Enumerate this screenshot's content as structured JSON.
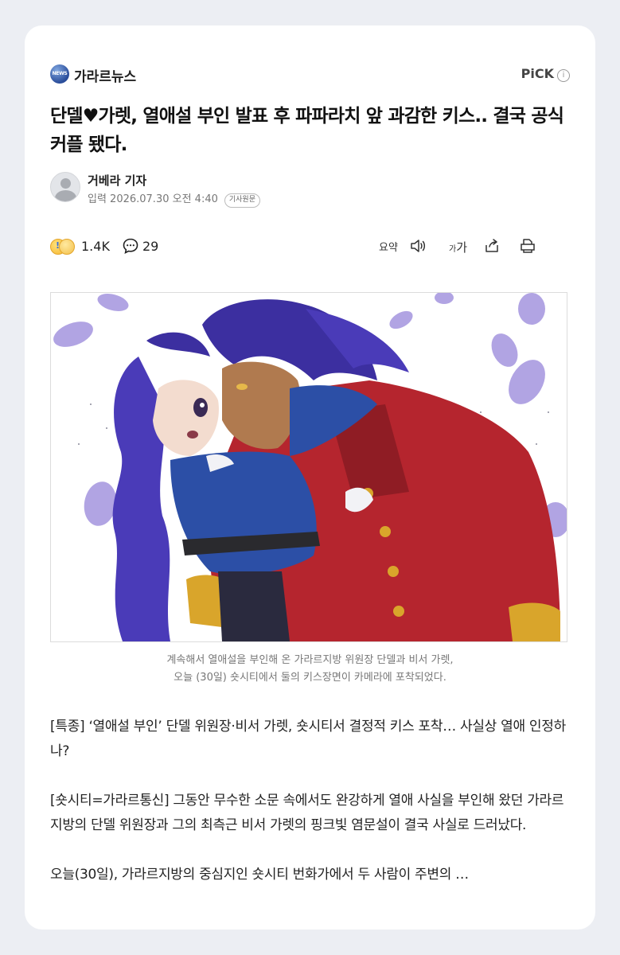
{
  "press": {
    "logo_text": "NEWS",
    "name": "가라르뉴스",
    "pick_label": "PiCK",
    "pick_info": "i"
  },
  "article": {
    "headline": "단델♥가렛, 열애설 부인 발표 후 파파라치 앞 과감한 키스.. 결국 공식 커플 됐다.",
    "reporter": "거베라 기자",
    "date": "입력 2026.07.30 오전 4:40",
    "original_button": "기사원문"
  },
  "stats": {
    "reaction_count": "1.4K",
    "comment_count": "29"
  },
  "toolbar": {
    "summary_label": "요약",
    "font_label_small": "가",
    "font_label_large": "가"
  },
  "image_caption": {
    "line1": "계속해서 열애설을 부인해 온 가라르지방 위원장 단델과 비서 가렛,",
    "line2": "오늘 (30일) 숏시티에서 둘의 키스장면이 카메라에 포착되었다."
  },
  "body": {
    "p1": "[특종] ‘열애설 부인’ 단델 위원장·비서 가렛, 숏시티서 결정적 키스 포착… 사실상 열애 인정하나?",
    "p2": "[숏시티=가라르통신] 그동안 무수한 소문 속에서도 완강하게 열애 사실을 부인해 왔던 가라르지방의 단델 위원장과 그의 최측근 비서 가렛의 핑크빛 염문설이 결국 사실로 드러났다.",
    "p3": "오늘(30일), 가라르지방의 중심지인 숏시티 번화가에서 두 사람이 주변의 …"
  },
  "colors": {
    "background": "#eceef3",
    "card": "#ffffff",
    "hair_purple": "#4a3bb8",
    "coat_red": "#b5252e",
    "jacket_blue": "#2c4fa6",
    "petal_lavender": "#a99ae0"
  }
}
